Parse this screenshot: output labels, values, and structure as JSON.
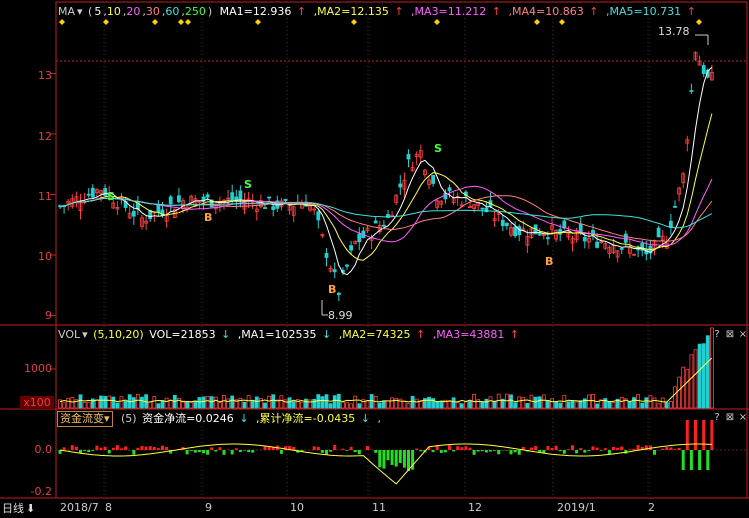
{
  "colors": {
    "up": "#ff4040",
    "down": "#20d0d0",
    "ma1": "#ffffff",
    "ma2": "#ffff40",
    "ma3": "#ff60ff",
    "ma4": "#ff8080",
    "ma5": "#40e0e0",
    "axis": "#c02020",
    "text": "#cccccc"
  },
  "main": {
    "indicator": "MA",
    "params_open": "(",
    "params": [
      "5",
      "10",
      "20",
      "30",
      "60",
      "250"
    ],
    "params_close": ")",
    "ma_values": [
      {
        "label": "MA1=12.936",
        "arrow": "↑"
      },
      {
        "label": "MA2=12.135",
        "arrow": "↑"
      },
      {
        "label": "MA3=11.212",
        "arrow": "↑"
      },
      {
        "label": "MA4=10.863",
        "arrow": "↑"
      },
      {
        "label": "MA5=10.731",
        "arrow": "↑"
      }
    ],
    "y_ticks": [
      "13",
      "12",
      "11",
      "10",
      "9"
    ],
    "high_label": "13.78",
    "low_label": "8.99",
    "signals": [
      "S",
      "S",
      "S",
      "B",
      "B",
      "B",
      "B"
    ]
  },
  "volume": {
    "indicator": "VOL",
    "params": "(5,10,20)",
    "vol_label": "VOL=21853",
    "vol_arrow": "↓",
    "ma_values": [
      {
        "label": "MA1=102535",
        "arrow": "↓"
      },
      {
        "label": "MA2=74325",
        "arrow": "↑"
      },
      {
        "label": "MA3=43881",
        "arrow": "↑"
      }
    ],
    "y_ticks": [
      "1000"
    ],
    "unit": "x100"
  },
  "fund": {
    "indicator": "资金流变",
    "params": "(5)",
    "net_label": "资金净流=0.0246",
    "net_arrow": "↓",
    "cum_label": "累计净流=-0.0435",
    "cum_arrow": "↓",
    "trail": ",",
    "y_ticks": [
      "0.0",
      "-0.2"
    ]
  },
  "xaxis": {
    "period": "日线",
    "period_arrow": "⬇",
    "labels": [
      "2018/7",
      "8",
      "9",
      "10",
      "11",
      "12",
      "2019/1",
      "2"
    ]
  },
  "icons": [
    "question-icon",
    "close-icon"
  ]
}
